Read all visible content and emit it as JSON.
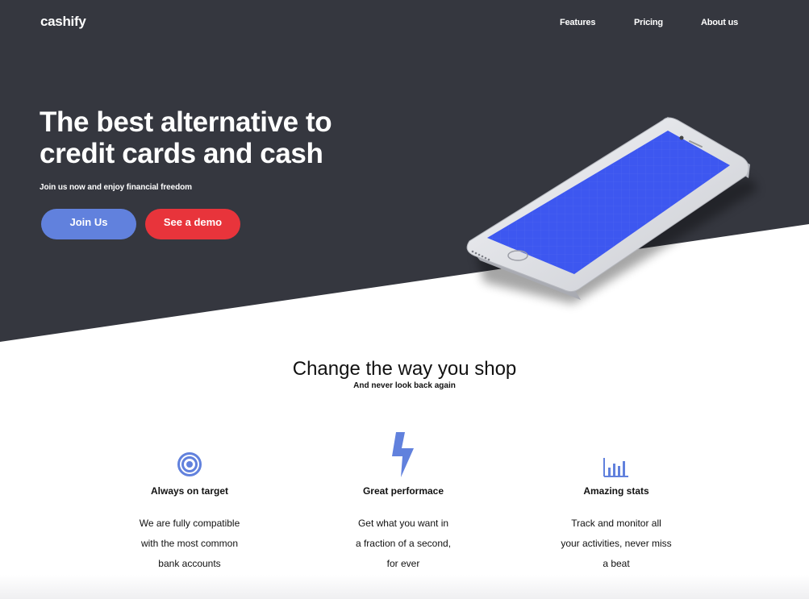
{
  "header": {
    "logo": "cashify",
    "nav": [
      {
        "label": "Features"
      },
      {
        "label": "Pricing"
      },
      {
        "label": "About us"
      }
    ]
  },
  "hero": {
    "headline_line1": "The best alternative to",
    "headline_line2": "credit cards and cash",
    "subheadline": "Join us now and enjoy financial freedom",
    "primary_button": "Join Us",
    "secondary_button": "See a demo"
  },
  "section": {
    "title": "Change the way you shop",
    "subtitle": "And never look back again"
  },
  "features": [
    {
      "icon": "target-icon",
      "title": "Always on target",
      "lines": [
        "We are fully compatible",
        "with the most common",
        "bank accounts"
      ]
    },
    {
      "icon": "lightning-bolt-icon",
      "title": "Great performace",
      "lines": [
        "Get what you want in",
        "a fraction of a second,",
        "for ever"
      ]
    },
    {
      "icon": "bar-chart-icon",
      "title": "Amazing stats",
      "lines": [
        "Track and monitor all",
        "your activities, never miss",
        "a beat"
      ]
    }
  ],
  "colors": {
    "hero_background": "#35373f",
    "primary_button": "#6181dd",
    "secondary_button": "#e8343b",
    "accent_icon": "#6181dd",
    "phone_screen": "#3d57f0"
  }
}
